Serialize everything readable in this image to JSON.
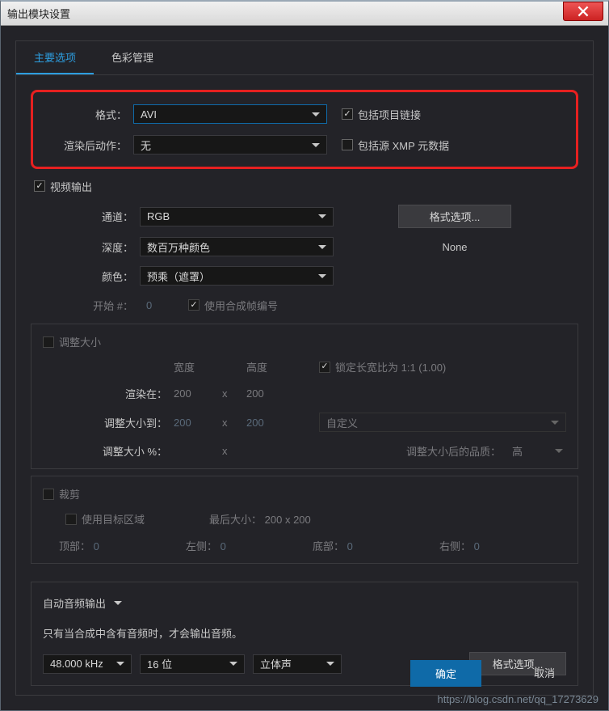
{
  "window": {
    "title": "输出模块设置"
  },
  "tabs": {
    "main": "主要选项",
    "color": "色彩管理"
  },
  "format": {
    "format_label": "格式：",
    "format_value": "AVI",
    "include_link": "包括项目链接",
    "post_render_label": "渲染后动作：",
    "post_render_value": "无",
    "include_xmp": "包括源 XMP 元数据"
  },
  "video": {
    "output_label": "视频输出",
    "channels_label": "通道：",
    "channels_value": "RGB",
    "depth_label": "深度：",
    "depth_value": "数百万种颜色",
    "color_label": "颜色：",
    "color_value": "预乘（遮罩）",
    "start_label": "开始 #：",
    "start_value": "0",
    "use_comp_frame": "使用合成帧编号",
    "format_options_btn": "格式选项...",
    "none_text": "None"
  },
  "resize": {
    "title": "调整大小",
    "width_label": "宽度",
    "height_label": "高度",
    "lock_aspect": "锁定长宽比为 1:1 (1.00)",
    "render_at_label": "渲染在：",
    "render_w": "200",
    "render_h": "200",
    "resize_to_label": "调整大小到：",
    "resize_w": "200",
    "resize_h": "200",
    "preset_value": "自定义",
    "resize_pct_label": "调整大小 %：",
    "quality_label": "调整大小后的品质：",
    "quality_value": "高",
    "x": "x"
  },
  "crop": {
    "title": "裁剪",
    "use_roi": "使用目标区域",
    "final_size_label": "最后大小：",
    "final_size_value": "200 x 200",
    "top_label": "顶部：",
    "top_value": "0",
    "left_label": "左侧：",
    "left_value": "0",
    "bottom_label": "底部：",
    "bottom_value": "0",
    "right_label": "右侧：",
    "right_value": "0"
  },
  "audio": {
    "mode": "自动音频输出",
    "note": "只有当合成中含有音频时，才会输出音频。",
    "rate": "48.000 kHz",
    "bits": "16 位",
    "channels": "立体声",
    "format_options_btn": "格式选项..."
  },
  "buttons": {
    "ok": "确定",
    "cancel": "取消"
  },
  "watermark": "https://blog.csdn.net/qq_17273629"
}
